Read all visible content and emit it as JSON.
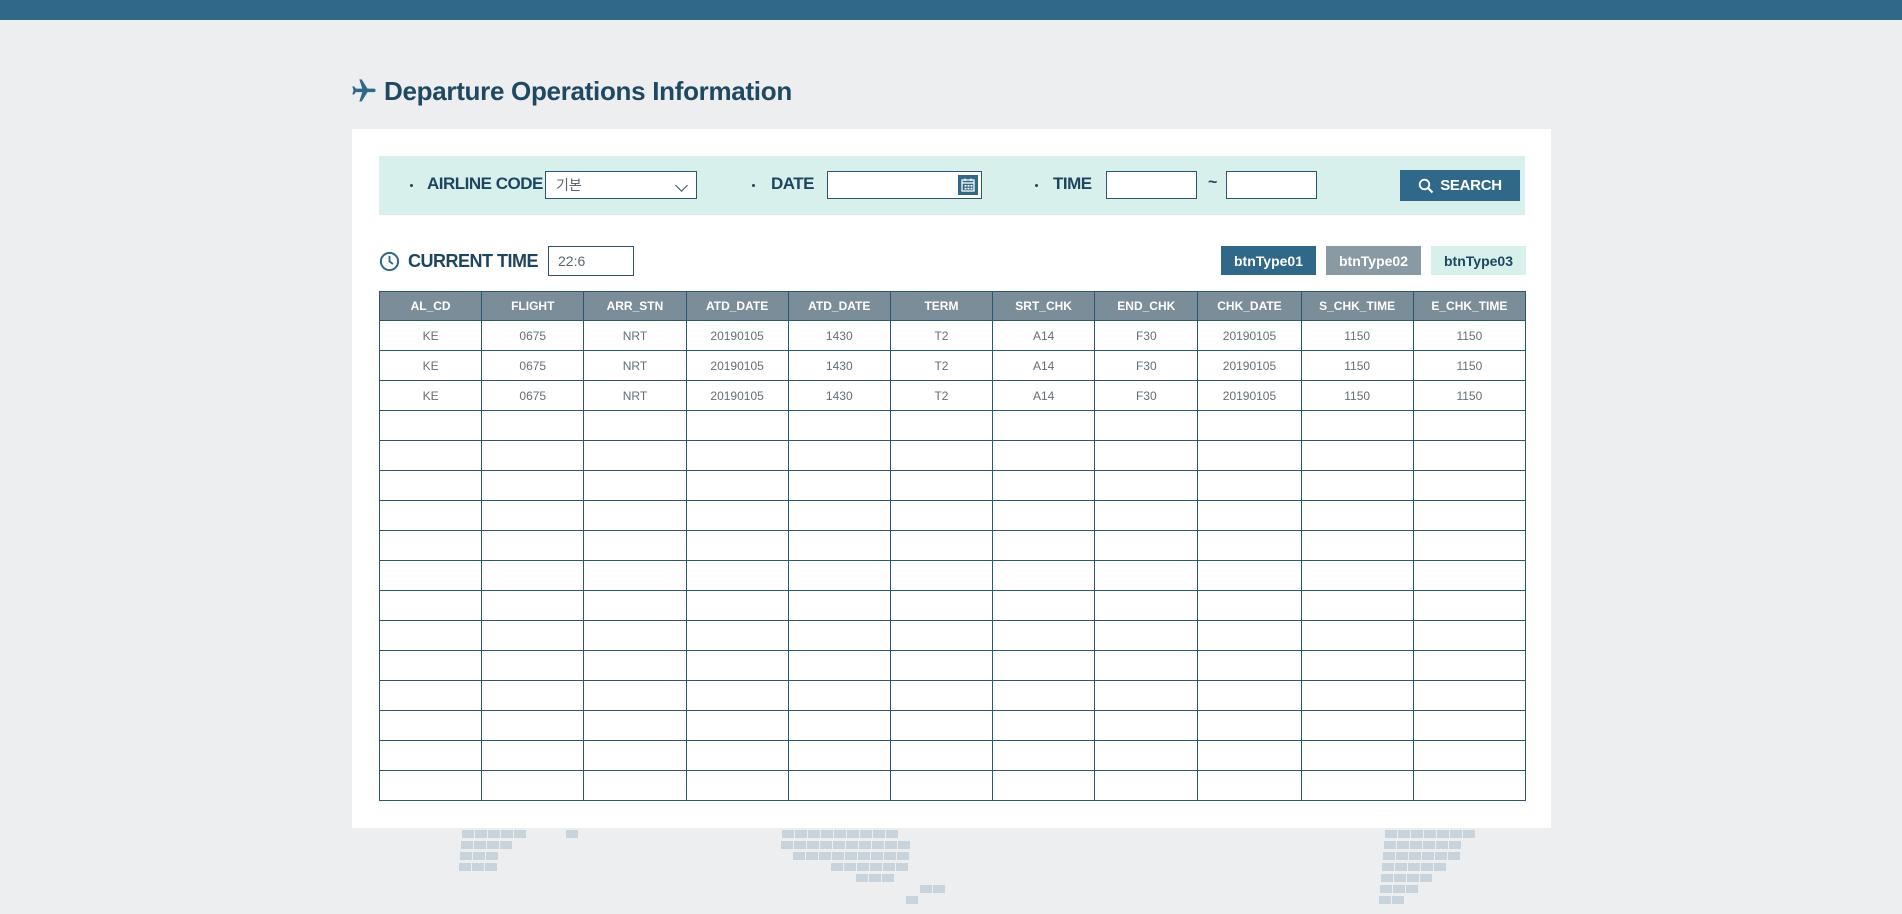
{
  "page": {
    "title": "Departure Operations Information"
  },
  "search": {
    "airline_code_label": "AIRLINE CODE",
    "airline_code_value": "기본",
    "date_label": "DATE",
    "date_value": "",
    "time_label": "TIME",
    "time_from": "",
    "time_separator": "~",
    "time_to": "",
    "search_button": "SEARCH"
  },
  "current_time": {
    "label": "CURRENT TIME",
    "value": "22:6"
  },
  "buttons": {
    "type01": "btnType01",
    "type02": "btnType02",
    "type03": "btnType03"
  },
  "colors": {
    "primary": "#2f6888",
    "header_bg": "#7b8d99",
    "search_bg": "#d8f0ec",
    "page_bg": "#eceef0"
  },
  "table": {
    "columns": [
      "AL_CD",
      "FLIGHT",
      "ARR_STN",
      "ATD_DATE",
      "ATD_DATE",
      "TERM",
      "SRT_CHK",
      "END_CHK",
      "CHK_DATE",
      "S_CHK_TIME",
      "E_CHK_TIME"
    ],
    "rows": [
      [
        "KE",
        "0675",
        "NRT",
        "20190105",
        "1430",
        "T2",
        "A14",
        "F30",
        "20190105",
        "1150",
        "1150"
      ],
      [
        "KE",
        "0675",
        "NRT",
        "20190105",
        "1430",
        "T2",
        "A14",
        "F30",
        "20190105",
        "1150",
        "1150"
      ],
      [
        "KE",
        "0675",
        "NRT",
        "20190105",
        "1430",
        "T2",
        "A14",
        "F30",
        "20190105",
        "1150",
        "1150"
      ],
      [
        "",
        "",
        "",
        "",
        "",
        "",
        "",
        "",
        "",
        "",
        ""
      ],
      [
        "",
        "",
        "",
        "",
        "",
        "",
        "",
        "",
        "",
        "",
        ""
      ],
      [
        "",
        "",
        "",
        "",
        "",
        "",
        "",
        "",
        "",
        "",
        ""
      ],
      [
        "",
        "",
        "",
        "",
        "",
        "",
        "",
        "",
        "",
        "",
        ""
      ],
      [
        "",
        "",
        "",
        "",
        "",
        "",
        "",
        "",
        "",
        "",
        ""
      ],
      [
        "",
        "",
        "",
        "",
        "",
        "",
        "",
        "",
        "",
        "",
        ""
      ],
      [
        "",
        "",
        "",
        "",
        "",
        "",
        "",
        "",
        "",
        "",
        ""
      ],
      [
        "",
        "",
        "",
        "",
        "",
        "",
        "",
        "",
        "",
        "",
        ""
      ],
      [
        "",
        "",
        "",
        "",
        "",
        "",
        "",
        "",
        "",
        "",
        ""
      ],
      [
        "",
        "",
        "",
        "",
        "",
        "",
        "",
        "",
        "",
        "",
        ""
      ],
      [
        "",
        "",
        "",
        "",
        "",
        "",
        "",
        "",
        "",
        "",
        ""
      ],
      [
        "",
        "",
        "",
        "",
        "",
        "",
        "",
        "",
        "",
        "",
        ""
      ],
      [
        "",
        "",
        "",
        "",
        "",
        "",
        "",
        "",
        "",
        "",
        ""
      ]
    ]
  }
}
